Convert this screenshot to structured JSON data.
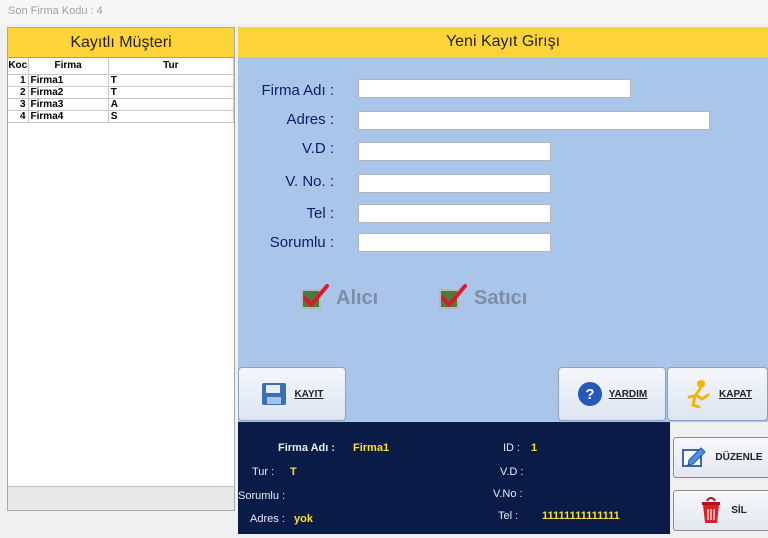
{
  "top_title": "Son Firma Kodu : 4",
  "left_panel": {
    "title": "Kayıtlı Müşteri",
    "columns": [
      "Koc",
      "Firma",
      "Tur"
    ],
    "rows": [
      [
        "1",
        "Firma1",
        "T"
      ],
      [
        "2",
        "Firma2",
        "T"
      ],
      [
        "3",
        "Firma3",
        "A"
      ],
      [
        "4",
        "Firma4",
        "S"
      ]
    ]
  },
  "right_panel": {
    "title": "Yeni Kayıt Girışı",
    "labels": {
      "firma": "Firma Adı :",
      "adres": "Adres :",
      "vd": "V.D :",
      "vno": "V. No. :",
      "tel": "Tel :",
      "sorumlu": "Sorumlu :"
    },
    "inputs": {
      "firma": "",
      "adres": "",
      "vd": "",
      "vno": "",
      "tel": "",
      "sorumlu": ""
    },
    "checks": {
      "alici": "Alıcı",
      "satici": "Satıcı"
    },
    "buttons": {
      "kayit": "KAYIT",
      "yardim": "YARDIM",
      "kapat": "KAPAT"
    }
  },
  "info": {
    "firma_label": "Firma Adı :",
    "firma_value": "Firma1",
    "tur_label": "Tur :",
    "tur_value": "T",
    "sorumlu_label": "Sorumlu :",
    "adres_label": "Adres :",
    "adres_value": "yok",
    "id_label": "ID :",
    "id_value": "1",
    "vd_label": "V.D :",
    "vno_label": "V.No :",
    "tel_label": "Tel :",
    "tel_value": "11111111111111"
  },
  "side_buttons": {
    "duzenle": "DÜZENLE",
    "sil": "SİL"
  },
  "colors": {
    "header_yellow": "#ffd43b",
    "form_blue": "#a9c6ea",
    "info_navy": "#0a1b48",
    "label_navy": "#0f1c66",
    "value_yellow": "#ffdd33"
  }
}
